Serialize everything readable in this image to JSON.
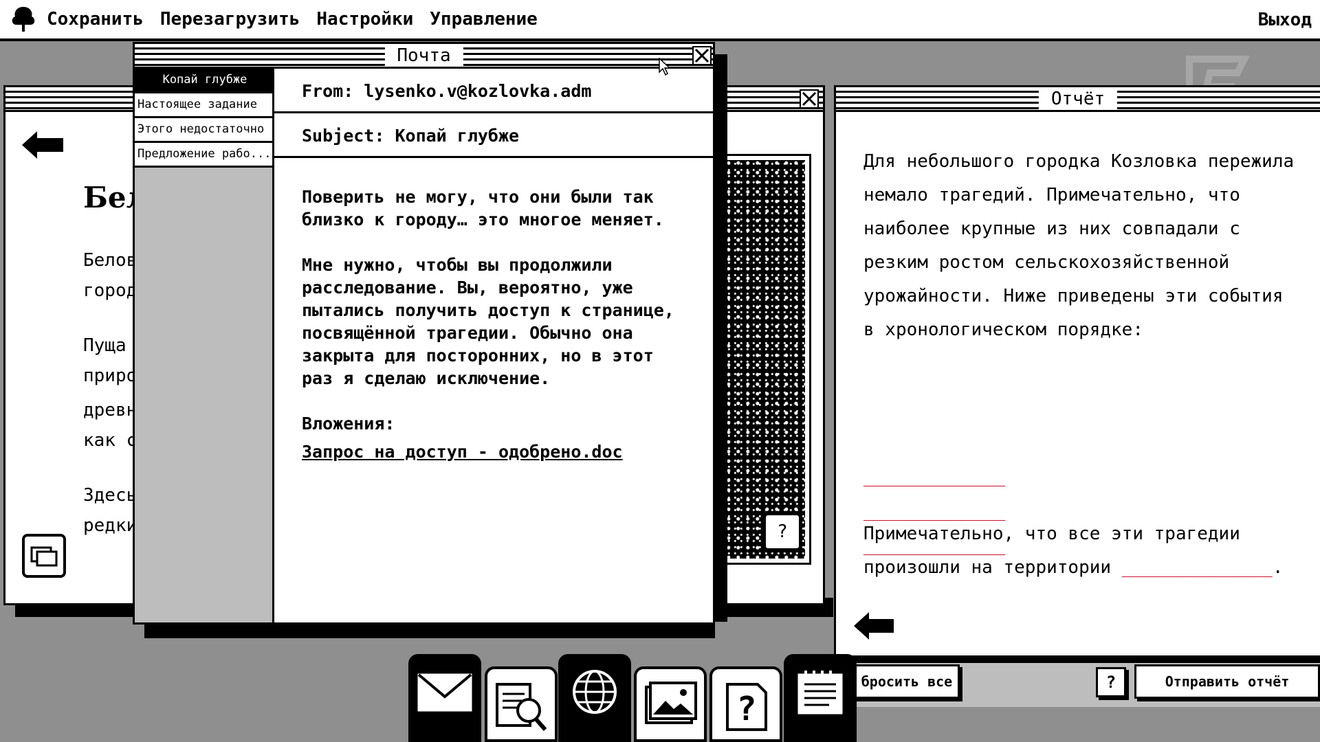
{
  "menubar": {
    "save": "Сохранить",
    "reload": "Перезагрузить",
    "settings": "Настройки",
    "manage": "Управление",
    "exit": "Выход"
  },
  "article": {
    "title_partial": "Бел",
    "lines": [
      "Белов",
      "город",
      "Пуща",
      "приро",
      "древн",
      "как с",
      "Здесь",
      "редки"
    ]
  },
  "mail": {
    "title": "Почта",
    "items": [
      "Копай глубже",
      "Настоящее задание",
      "Этого недостаточно",
      "Предложение рабо..."
    ],
    "selected_index": 0,
    "from": "From: lysenko.v@kozlovka.adm",
    "subject": "Subject: Копай глубже",
    "body": [
      "Поверить не могу, что они были так\nблизко к городу… это многое меняет.",
      "Мне нужно, чтобы вы продолжили\nрасследование. Вы, вероятно, уже\nпытались получить доступ к странице,\nпосвящённой трагедии. Обычно она\nзакрыта для посторонних, но в этот\nраз я сделаю исключение."
    ],
    "attachments_label": "Вложения:",
    "attachment": "Запрос на доступ - одобрено.doc"
  },
  "report": {
    "title": "Отчёт",
    "intro": "Для небольшого городка Козловка пережила немало трагедий. Примечательно, что наиболее крупные из них совпадали с резким ростом сельскохозяйственной урожайности. Ниже приведены эти события в хронологическом порядке:",
    "blank": "______________",
    "conclusion_prefix": "Примечательно, что все эти трагедии произошли на территории",
    "conclusion_suffix": ".",
    "reset_button": "бросить все",
    "help": "?",
    "submit_button": "Отправить отчёт"
  },
  "photo": {
    "help": "?"
  },
  "dock": [
    "mail-icon",
    "search-document-icon",
    "globe-icon",
    "image-icon",
    "help-document-icon",
    "notepad-icon"
  ],
  "colors": {
    "accent_red": "#c8102e",
    "desktop": "#8f8f8f"
  }
}
